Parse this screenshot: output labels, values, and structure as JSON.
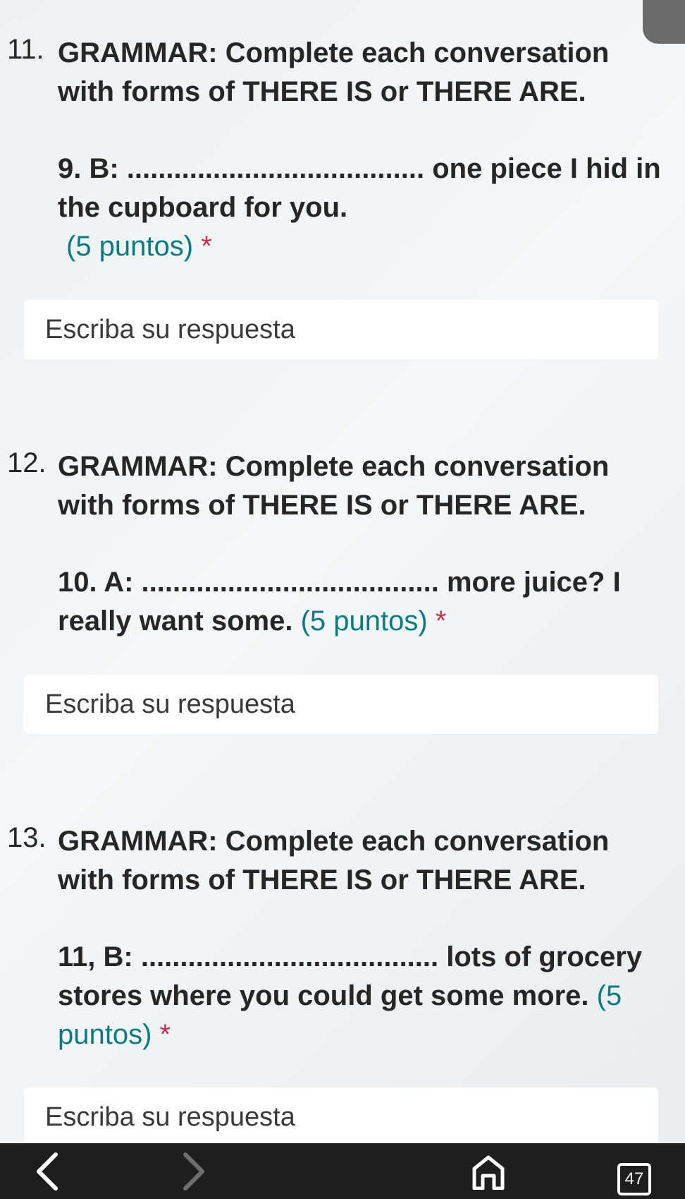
{
  "questions": [
    {
      "number": "11.",
      "title": "GRAMMAR: Complete each conversation with forms of THERE IS or THERE ARE.",
      "prompt": "9. B: ...................................... one piece I hid in the cupboard for you.",
      "points": "(5 puntos)",
      "required": "*",
      "placeholder": "Escriba su respuesta"
    },
    {
      "number": "12.",
      "title": "GRAMMAR: Complete each conversation with forms of THERE IS or THERE ARE.",
      "prompt": "10. A: ...................................... more juice? I really want some.",
      "points": "(5 puntos)",
      "required": "*",
      "placeholder": "Escriba su respuesta"
    },
    {
      "number": "13.",
      "title": "GRAMMAR: Complete each conversation with forms of THERE IS or THERE ARE.",
      "prompt": "11, B: ...................................... lots of grocery stores where you could get some more.",
      "points": "(5 puntos)",
      "required": "*",
      "placeholder": "Escriba su respuesta"
    }
  ],
  "bottom_bar": {
    "icons": [
      "back-icon",
      "forward-icon",
      "home-icon",
      "tabs-icon"
    ],
    "tab_count": "47"
  },
  "colors": {
    "points": "#0a7b83",
    "required": "#c4314b",
    "bar": "#1e1e1e"
  }
}
